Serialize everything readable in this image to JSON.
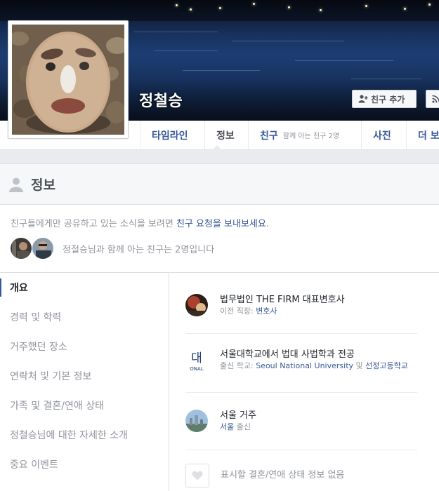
{
  "profile": {
    "name": "정철승"
  },
  "cover_actions": {
    "add_friend_label": "친구 추가"
  },
  "nav": {
    "timeline": "타임라인",
    "about": "정보",
    "friends": "친구",
    "friends_sub": "함께 아는 친구 2명",
    "photos": "사진",
    "more": "더 보기"
  },
  "section": {
    "title": "정보"
  },
  "notice": {
    "prefix": "친구들에게만 공유하고 있는 소식을 보려면 ",
    "link": "친구 요청을 보내보세요",
    "suffix": "."
  },
  "mutual": {
    "text": "정철승님과 함께 아는 친구는 2명입니다"
  },
  "about_menu": [
    {
      "label": "개요"
    },
    {
      "label": "경력 및 학력"
    },
    {
      "label": "거주했던 장소"
    },
    {
      "label": "연락처 및 기본 정보"
    },
    {
      "label": "가족 및 결혼/연애 상태"
    },
    {
      "label": "정철승님에 대한 자세한 소개"
    },
    {
      "label": "중요 이벤트"
    }
  ],
  "overview": {
    "work": {
      "main": "법무법인 THE FIRM 대표변호사",
      "sub_label": "이전 직장: ",
      "sub_value": "변호사"
    },
    "education": {
      "main": "서울대학교에서 법대 사법학과 전공",
      "sub_label": "출신 학교: ",
      "school1": "Seoul National University",
      "and": " 및 ",
      "school2": "선정고등학교"
    },
    "residence": {
      "main": "서울 거주",
      "origin": "서울",
      "origin_suffix": " 출신"
    },
    "relationship": {
      "main": "표시할 결혼/연애 상태 정보 없음"
    }
  },
  "colors": {
    "link": "#365899",
    "muted": "#90949c",
    "border": "#dddfe2",
    "background": "#e9ebee"
  },
  "icons": {
    "add_friend": "person-plus-icon",
    "follow": "rss-icon",
    "section": "person-icon",
    "relationship": "heart-icon"
  }
}
